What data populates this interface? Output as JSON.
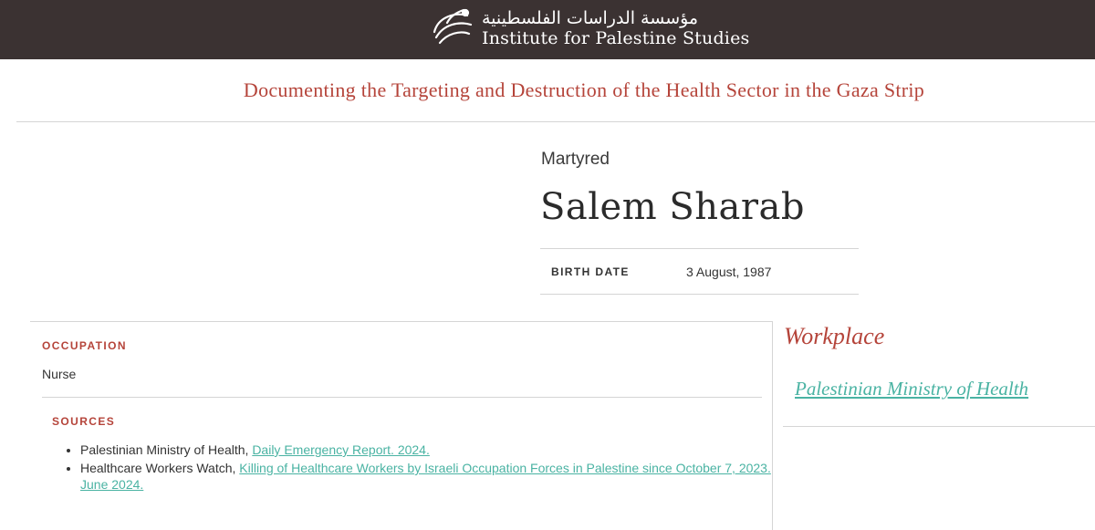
{
  "header": {
    "logo_arabic": "مؤسسة الدراسات الفلسطينية",
    "logo_english": "Institute for Palestine Studies"
  },
  "page_title": "Documenting the Targeting and Destruction of the Health Sector in the Gaza Strip",
  "person": {
    "status": "Martyred",
    "name": "Salem Sharab",
    "birth_date_label": "BIRTH DATE",
    "birth_date": "3 August, 1987"
  },
  "occupation": {
    "label": "OCCUPATION",
    "value": "Nurse"
  },
  "sources": {
    "label": "SOURCES",
    "items": [
      {
        "author": "Palestinian Ministry of Health, ",
        "link": "Daily Emergency Report. 2024."
      },
      {
        "author": "Healthcare Workers Watch, ",
        "link": "Killing of Healthcare Workers by Israeli Occupation Forces in Palestine since October 7, 2023. June 2024."
      }
    ]
  },
  "workplace": {
    "title": "Workplace",
    "name": "Palestinian Ministry of Health"
  },
  "colors": {
    "header_bg": "#3b3232",
    "accent_red": "#b5443a",
    "link_teal": "#4ab3a3"
  },
  "icons": {
    "logo": "bird-logo-icon"
  }
}
